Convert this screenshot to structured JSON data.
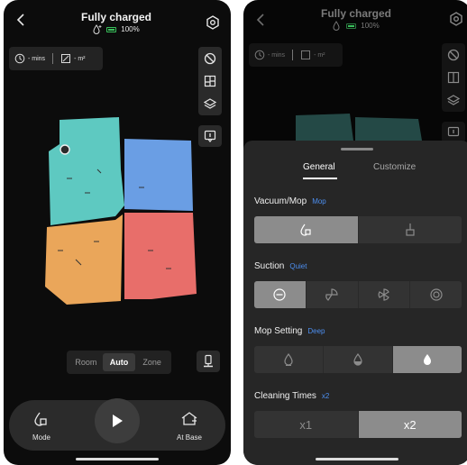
{
  "status": {
    "title": "Fully charged",
    "battery": "100%"
  },
  "stats": {
    "time": "- mins",
    "area": "- m²"
  },
  "map_colors": {
    "teal": "#5ec9c1",
    "blue": "#6a9ee4",
    "orange": "#eaa65a",
    "red": "#e86e6a"
  },
  "modes": {
    "room": "Room",
    "auto": "Auto",
    "zone": "Zone"
  },
  "bottom": {
    "mode_label": "Mode",
    "base_label": "At Base"
  },
  "sheet": {
    "tab_general": "General",
    "tab_customize": "Customize",
    "vacmop": {
      "title": "Vacuum/Mop",
      "value": "Mop"
    },
    "suction": {
      "title": "Suction",
      "value": "Quiet"
    },
    "mop": {
      "title": "Mop Setting",
      "value": "Deep"
    },
    "times": {
      "title": "Cleaning Times",
      "value": "x2",
      "opt1": "x1",
      "opt2": "x2"
    }
  },
  "accent": "#4d8ff0"
}
